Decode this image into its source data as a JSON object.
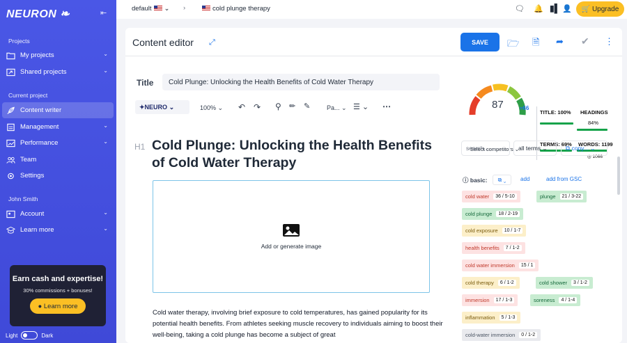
{
  "app": {
    "logo": "NEURON"
  },
  "sidebar": {
    "projects_heading": "Projects",
    "items": [
      {
        "label": "My projects"
      },
      {
        "label": "Shared projects"
      }
    ],
    "current_heading": "Current project",
    "current_items": [
      {
        "label": "Content writer"
      },
      {
        "label": "Management"
      },
      {
        "label": "Performance"
      },
      {
        "label": "Team"
      },
      {
        "label": "Settings"
      }
    ],
    "user_heading": "John Smith",
    "user_items": [
      {
        "label": "Account"
      },
      {
        "label": "Learn more"
      }
    ],
    "promo": {
      "title": "Earn cash and expertise!",
      "subtitle": "30% commissions + bonuses!",
      "button": "Learn more"
    },
    "theme": {
      "light": "Light",
      "dark": "Dark"
    }
  },
  "topbar": {
    "project": "default",
    "query": "cold plunge therapy",
    "upgrade": "Upgrade"
  },
  "editor": {
    "header_title": "Content editor",
    "save": "SAVE",
    "title_label": "Title",
    "title_value": "Cold Plunge: Unlocking the Health Benefits of Cold Water Therapy",
    "toolbar": {
      "brand": "NEURO",
      "zoom": "100%",
      "style": "Pa..."
    },
    "h1_tag": "H1",
    "h1": "Cold Plunge: Unlocking the Health Benefits of Cold Water Therapy",
    "image_label": "Add or generate image",
    "body": "Cold water therapy, involving brief exposure to cold temperatures, has gained popularity for its potential health benefits. From athletes seeking muscle recovery to individuals aiming to boost their well-being, taking a cold plunge has become a subject of great"
  },
  "score": {
    "value": "87",
    "competitors": "Select competitors",
    "target": "66",
    "metrics": {
      "title": "TITLE: 100%",
      "headings": "HEADINGS",
      "headings_val": "84%",
      "terms": "TERMS: 69%",
      "words": "WORDS: 1199",
      "words_sub": "1066"
    },
    "bars": {
      "title": 1.0,
      "headings": 0.84,
      "terms": 0.69,
      "words": 1.0
    }
  },
  "terms": {
    "search_placeholder": "search...",
    "filter": "all terms",
    "copy": "copy...",
    "basic_label": "basic:",
    "add": "add",
    "add_gsc": "add from GSC",
    "chips": [
      {
        "term": "cold water",
        "count": "36 / 5-10"
      },
      {
        "term": "plunge",
        "count": "21 / 3-22"
      },
      {
        "term": "cold plunge",
        "count": "18 / 2-19"
      },
      {
        "term": "cold exposure",
        "count": "10 / 1-7"
      },
      {
        "term": "health benefits",
        "count": "7 / 1-2"
      },
      {
        "term": "cold water immersion",
        "count": "15 / 1"
      },
      {
        "term": "cold therapy",
        "count": "6 / 1-2"
      },
      {
        "term": "cold shower",
        "count": "3 / 1-2"
      },
      {
        "term": "immersion",
        "count": "17 / 1-3"
      },
      {
        "term": "soreness",
        "count": "4 / 1-4"
      },
      {
        "term": "inflammation",
        "count": "5 / 1-3"
      },
      {
        "term": "cold-water immersion",
        "count": "0 / 1-2"
      }
    ]
  },
  "colors": {
    "accent": "#1a73e8",
    "sidebar": "#4a57e6",
    "upgrade": "#fbbf24"
  }
}
